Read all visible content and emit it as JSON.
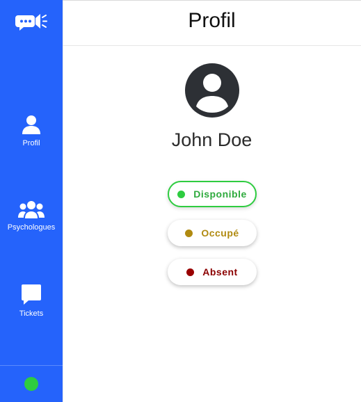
{
  "sidebar": {
    "items": [
      {
        "label": "Profil",
        "icon": "user-icon"
      },
      {
        "label": "Psychologues",
        "icon": "users-icon"
      },
      {
        "label": "Tickets",
        "icon": "chat-icon"
      }
    ],
    "status_color": "#2ecc40"
  },
  "header": {
    "title": "Profil"
  },
  "profile": {
    "name": "John Doe"
  },
  "statuses": [
    {
      "label": "Disponible",
      "color": "#2ecc40",
      "selected": true
    },
    {
      "label": "Occupé",
      "color": "#b08a10",
      "selected": false
    },
    {
      "label": "Absent",
      "color": "#990000",
      "selected": false
    }
  ],
  "colors": {
    "accent": "#2563fb"
  }
}
